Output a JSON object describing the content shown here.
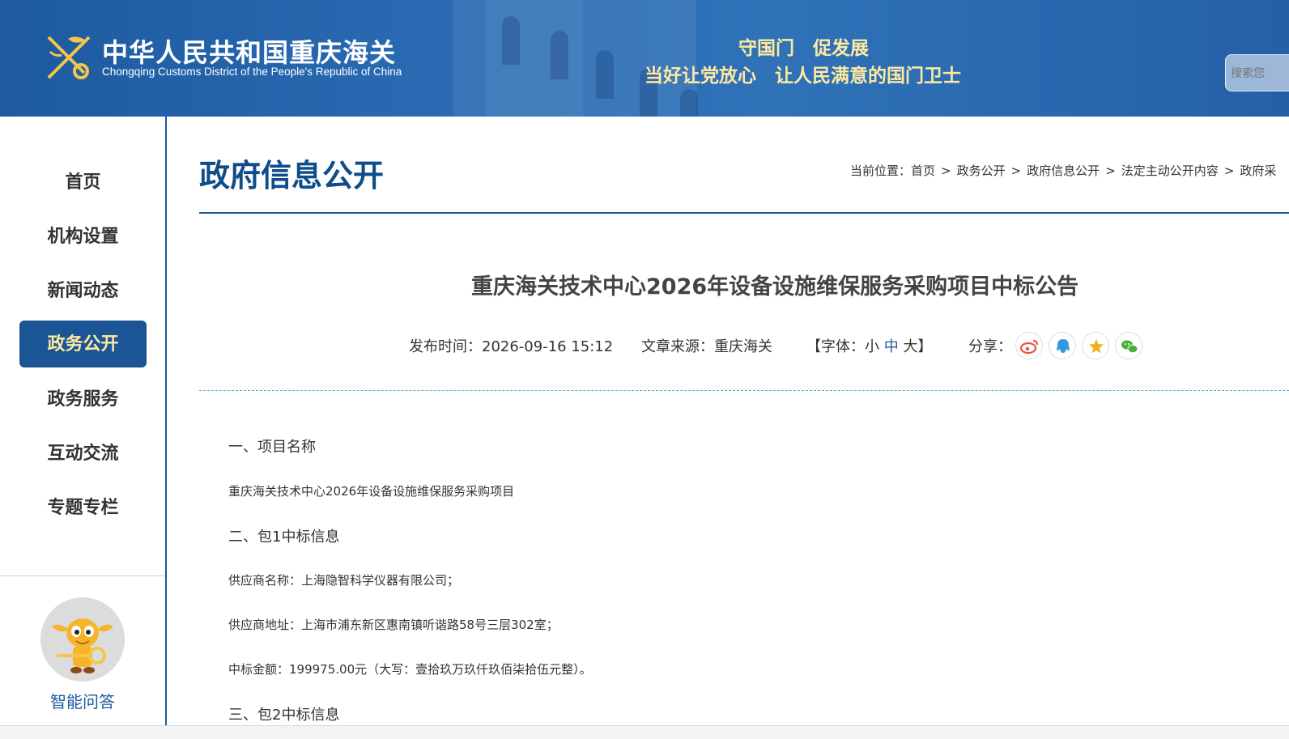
{
  "header": {
    "org_cn": "中华人民共和国重庆海关",
    "org_en": "Chongqing Customs District of the People's Republic of China",
    "slogan_line1": "守国门　促发展",
    "slogan_line2": "当好让党放心　让人民满意的国门卫士",
    "search_placeholder": "搜索您",
    "emblem_icon": "customs-emblem-icon"
  },
  "sidebar": {
    "items": [
      {
        "label": "首页",
        "active": false
      },
      {
        "label": "机构设置",
        "active": false
      },
      {
        "label": "新闻动态",
        "active": false
      },
      {
        "label": "政务公开",
        "active": true
      },
      {
        "label": "政务服务",
        "active": false
      },
      {
        "label": "互动交流",
        "active": false
      },
      {
        "label": "专题专栏",
        "active": false
      }
    ],
    "qa_label": "智能问答",
    "mascot_icon": "mascot-robot-icon",
    "active_color": "#1b5595",
    "active_text_color": "#ffe9a0"
  },
  "main": {
    "section_title": "政府信息公开",
    "breadcrumb_prefix": "当前位置：",
    "breadcrumb": [
      "首页",
      "政务公开",
      "政府信息公开",
      "法定主动公开内容",
      "政府采"
    ],
    "breadcrumb_sep": ">"
  },
  "article": {
    "title": "重庆海关技术中心2026年设备设施维保服务采购项目中标公告",
    "publish_label": "发布时间：",
    "publish_time": "2026-09-16 15:12",
    "source_label": "文章来源：",
    "source": "重庆海关",
    "font_open": "【字体：",
    "font_small": "小",
    "font_medium": "中",
    "font_large": "大",
    "font_close": "】",
    "share_label": "分享：",
    "share_icons": [
      "weibo-icon",
      "qq-icon",
      "qzone-icon",
      "wechat-icon"
    ],
    "share_colors": [
      "#e8553d",
      "#2f9ae0",
      "#f2b21b",
      "#4caf3d"
    ],
    "sections": {
      "h1": "一、项目名称",
      "p1": "重庆海关技术中心2026年设备设施维保服务采购项目",
      "h2": "二、包1中标信息",
      "p2": "供应商名称：上海隐智科学仪器有限公司；",
      "p3": "供应商地址：上海市浦东新区惠南镇听谐路58号三层302室；",
      "p4": "中标金额：199975.00元（大写：壹拾玖万玖仟玖佰柒拾伍元整）。",
      "h3": "三、包2中标信息"
    }
  }
}
